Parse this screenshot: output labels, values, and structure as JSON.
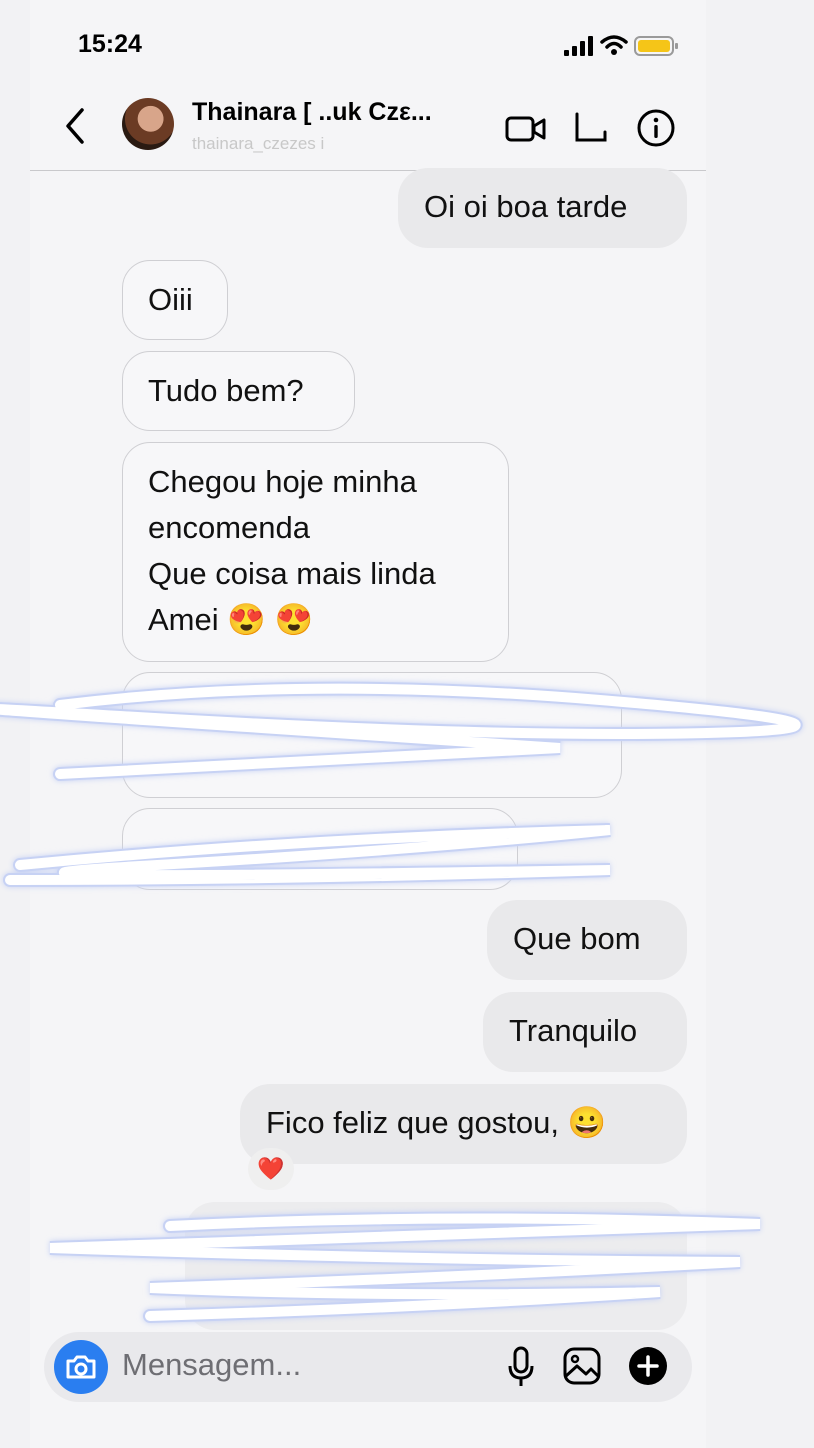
{
  "status_bar": {
    "time": "15:24"
  },
  "header": {
    "name": "Thainara [ ..uk Czε...",
    "handle": "thainara_czezes i",
    "icons": [
      "back-chevron-icon",
      "video-call-icon",
      "phone-call-icon",
      "info-icon"
    ]
  },
  "messages": [
    {
      "side": "out",
      "text": "Oi oi boa tarde"
    },
    {
      "side": "in",
      "text": "Oiii"
    },
    {
      "side": "in",
      "text": "Tudo bem?"
    },
    {
      "side": "in",
      "lines": [
        "Chegou hoje minha",
        "encomenda",
        "Que coisa mais linda",
        "Amei 😍 😍"
      ]
    },
    {
      "side": "in",
      "text": "[redacted]"
    },
    {
      "side": "in",
      "text": "[redacted]"
    },
    {
      "side": "out",
      "text": "Que bom"
    },
    {
      "side": "out",
      "text": "Tranquilo"
    },
    {
      "side": "out",
      "text": "Fico feliz que gostou, 😀",
      "reaction": "❤️"
    },
    {
      "side": "out",
      "text": "[redacted]"
    }
  ],
  "composer": {
    "placeholder": "Mensagem...",
    "icons": [
      "camera-icon",
      "microphone-icon",
      "gallery-icon",
      "plus-icon"
    ]
  },
  "colors": {
    "background": "#f5f5f7",
    "incoming_bubble_border": "#cfcfd3",
    "outgoing_bubble": "#e9e9eb",
    "camera_button": "#2a7ef0",
    "battery": "#f5c518"
  }
}
